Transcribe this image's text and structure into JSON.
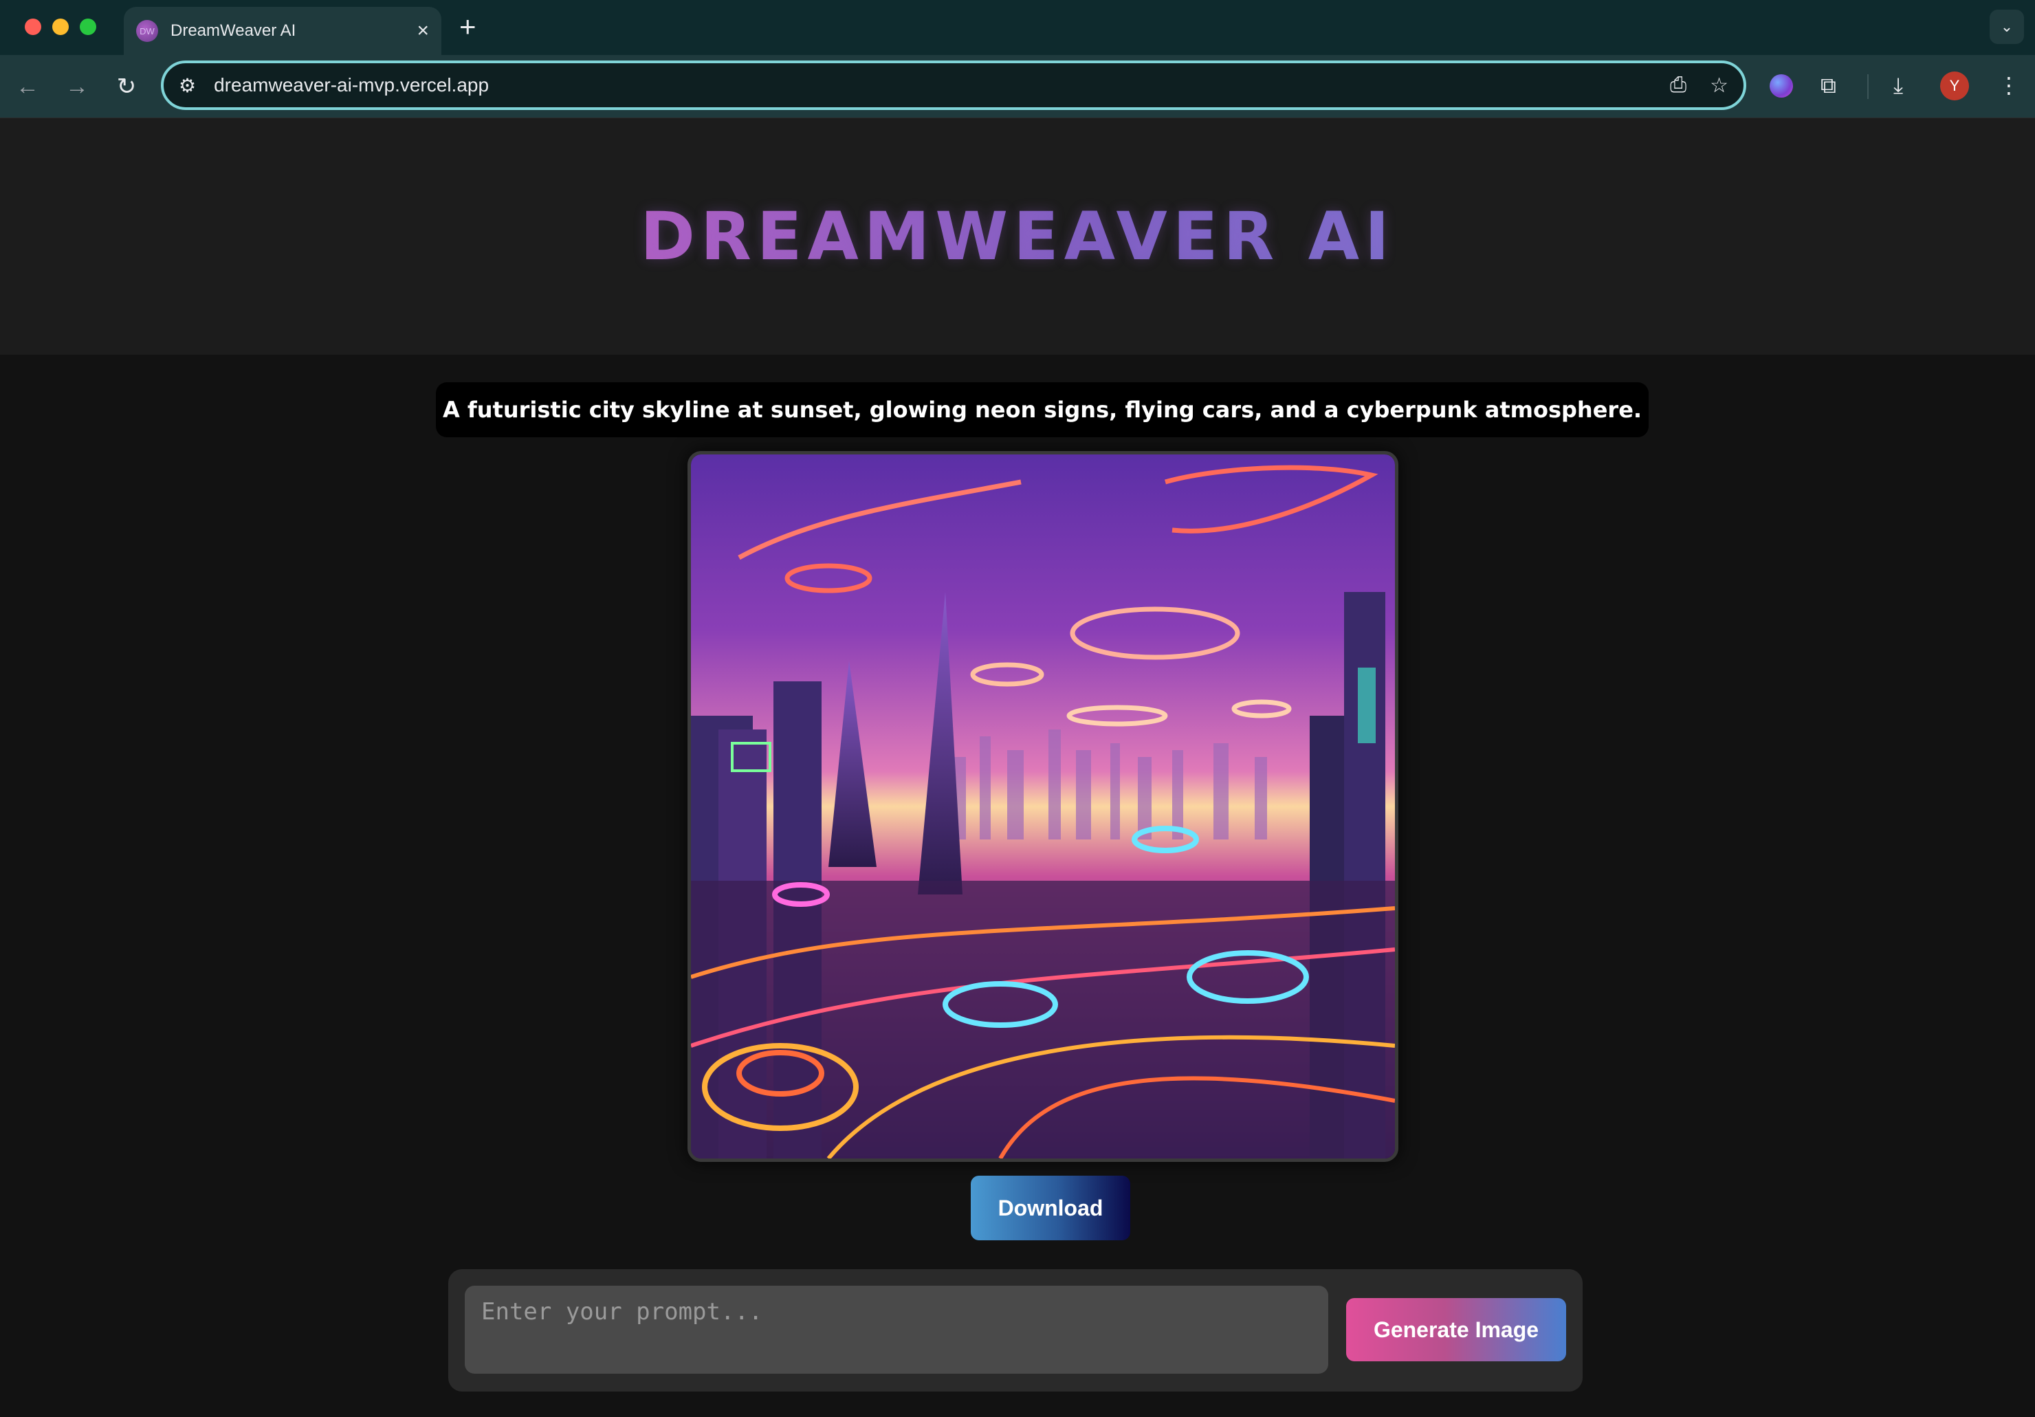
{
  "browser": {
    "tab_title": "DreamWeaver AI",
    "tab_favicon_text": "DW",
    "url": "dreamweaver-ai-mvp.vercel.app",
    "profile_initial": "Y",
    "icons": [
      "close-icon",
      "plus-icon",
      "chevron-down-icon",
      "back-icon",
      "forward-icon",
      "reload-icon",
      "tune-icon",
      "install-app-icon",
      "star-icon",
      "extension-sphere-icon",
      "puzzle-icon",
      "download-icon",
      "kebab-menu-icon"
    ]
  },
  "app": {
    "title": "DREAMWEAVER AI",
    "title_gradient": [
      "#b05fbf",
      "#7a6fc9"
    ]
  },
  "result": {
    "prompt_text": "A futuristic city skyline at sunset, glowing neon signs, flying cars, and a cyberpunk atmosphere.",
    "image_alt": "Generated cyberpunk city skyline at sunset with neon flying cars",
    "download_label": "Download"
  },
  "composer": {
    "placeholder": "Enter your prompt...",
    "value": "",
    "generate_label": "Generate Image"
  },
  "colors": {
    "page_bg": "#121212",
    "header_bg": "#1c1c1c",
    "omnibox_border": "#7fd4d8",
    "generate_gradient": [
      "#e0509a",
      "#4a7fd0"
    ],
    "download_gradient": [
      "#4a9ad2",
      "#0a0a4a"
    ]
  }
}
